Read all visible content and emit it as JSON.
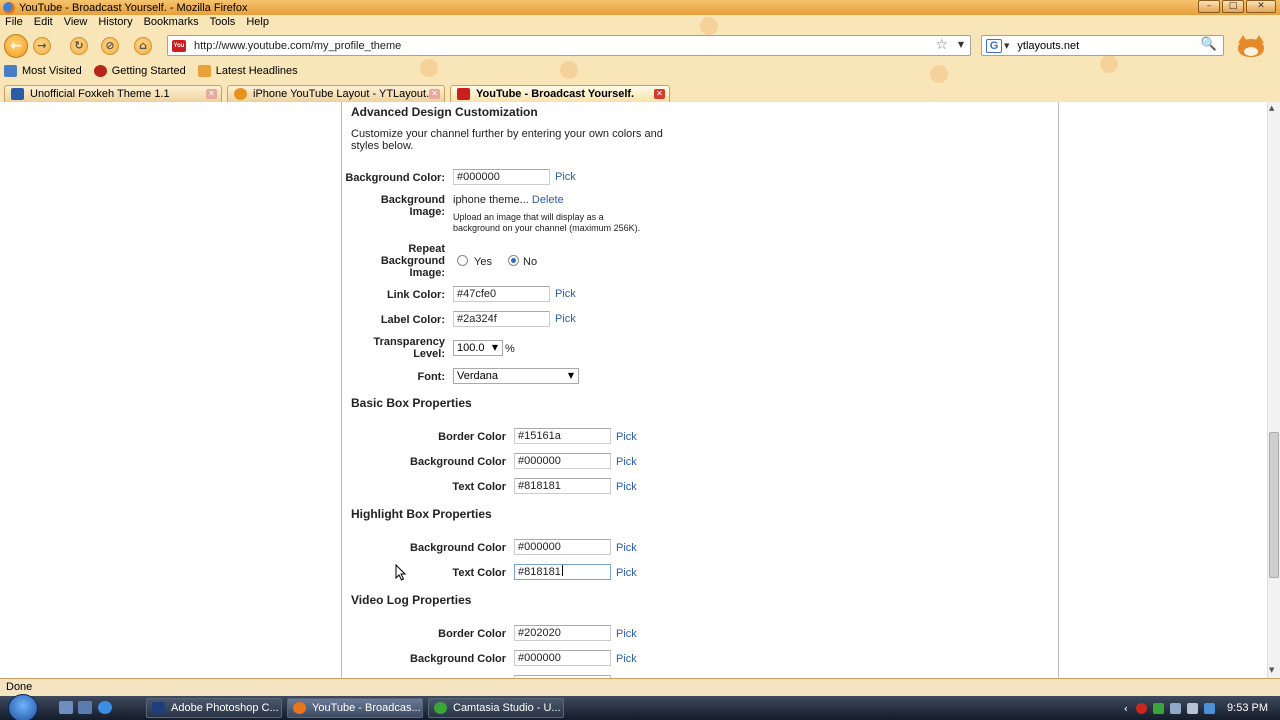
{
  "window": {
    "title": "YouTube - Broadcast Yourself. - Mozilla Firefox",
    "controls": [
      "–",
      "□",
      "✕"
    ]
  },
  "menu": [
    "File",
    "Edit",
    "View",
    "History",
    "Bookmarks",
    "Tools",
    "Help"
  ],
  "navigation": {
    "url": "http://www.youtube.com/my_profile_theme",
    "search_engine": "G",
    "search_query": "ytlayouts.net"
  },
  "bookmarks": [
    "Most Visited",
    "Getting Started",
    "Latest Headlines"
  ],
  "tabs": [
    {
      "label": "Unofficial Foxkeh Theme 1.1",
      "active": false
    },
    {
      "label": "iPhone YouTube Layout - YTLayout...",
      "active": false
    },
    {
      "label": "YouTube - Broadcast Yourself.",
      "active": true
    }
  ],
  "page": {
    "advanced": {
      "title": "Advanced Design Customization",
      "intro_line1": "Customize your channel further by entering your own colors and",
      "intro_line2": "styles below.",
      "bg_color_label": "Background Color:",
      "bg_color_value": "#000000",
      "bg_image_label_1": "Background",
      "bg_image_label_2": "Image:",
      "bg_image_name": "iphone theme...",
      "delete_link": "Delete",
      "bg_image_hint_1": "Upload an image that will display as a",
      "bg_image_hint_2": "background on your channel (maximum 256K).",
      "repeat_label_1": "Repeat",
      "repeat_label_2": "Background",
      "repeat_label_3": "Image:",
      "repeat_yes": "Yes",
      "repeat_no": "No",
      "repeat_selected": "No",
      "link_color_label": "Link Color:",
      "link_color_value": "#47cfe0",
      "label_color_label": "Label Color:",
      "label_color_value": "#2a324f",
      "transparency_label_1": "Transparency",
      "transparency_label_2": "Level:",
      "transparency_value": "100.0",
      "transparency_unit": "%",
      "font_label": "Font:",
      "font_value": "Verdana"
    },
    "basic_box": {
      "title": "Basic Box Properties",
      "border_label": "Border Color",
      "border_value": "#15161a",
      "background_label": "Background Color",
      "background_value": "#000000",
      "text_label": "Text Color",
      "text_value": "#818181"
    },
    "highlight_box": {
      "title": "Highlight Box Properties",
      "background_label": "Background Color",
      "background_value": "#000000",
      "text_label": "Text Color",
      "text_value": "#818181"
    },
    "video_log": {
      "title": "Video Log Properties",
      "border_label": "Border Color",
      "border_value": "#202020",
      "background_label": "Background Color",
      "background_value": "#000000"
    },
    "pick_label": "Pick"
  },
  "status": "Done",
  "taskbar": {
    "items": [
      {
        "label": "Adobe Photoshop C...",
        "active": false
      },
      {
        "label": "YouTube - Broadcas...",
        "active": true
      },
      {
        "label": "Camtasia Studio - U...",
        "active": false
      }
    ],
    "time": "9:53 PM"
  },
  "colors": {
    "chrome_bg": "#f9e6b8",
    "link": "#2a5db0",
    "taskbar": "#1c2636"
  }
}
